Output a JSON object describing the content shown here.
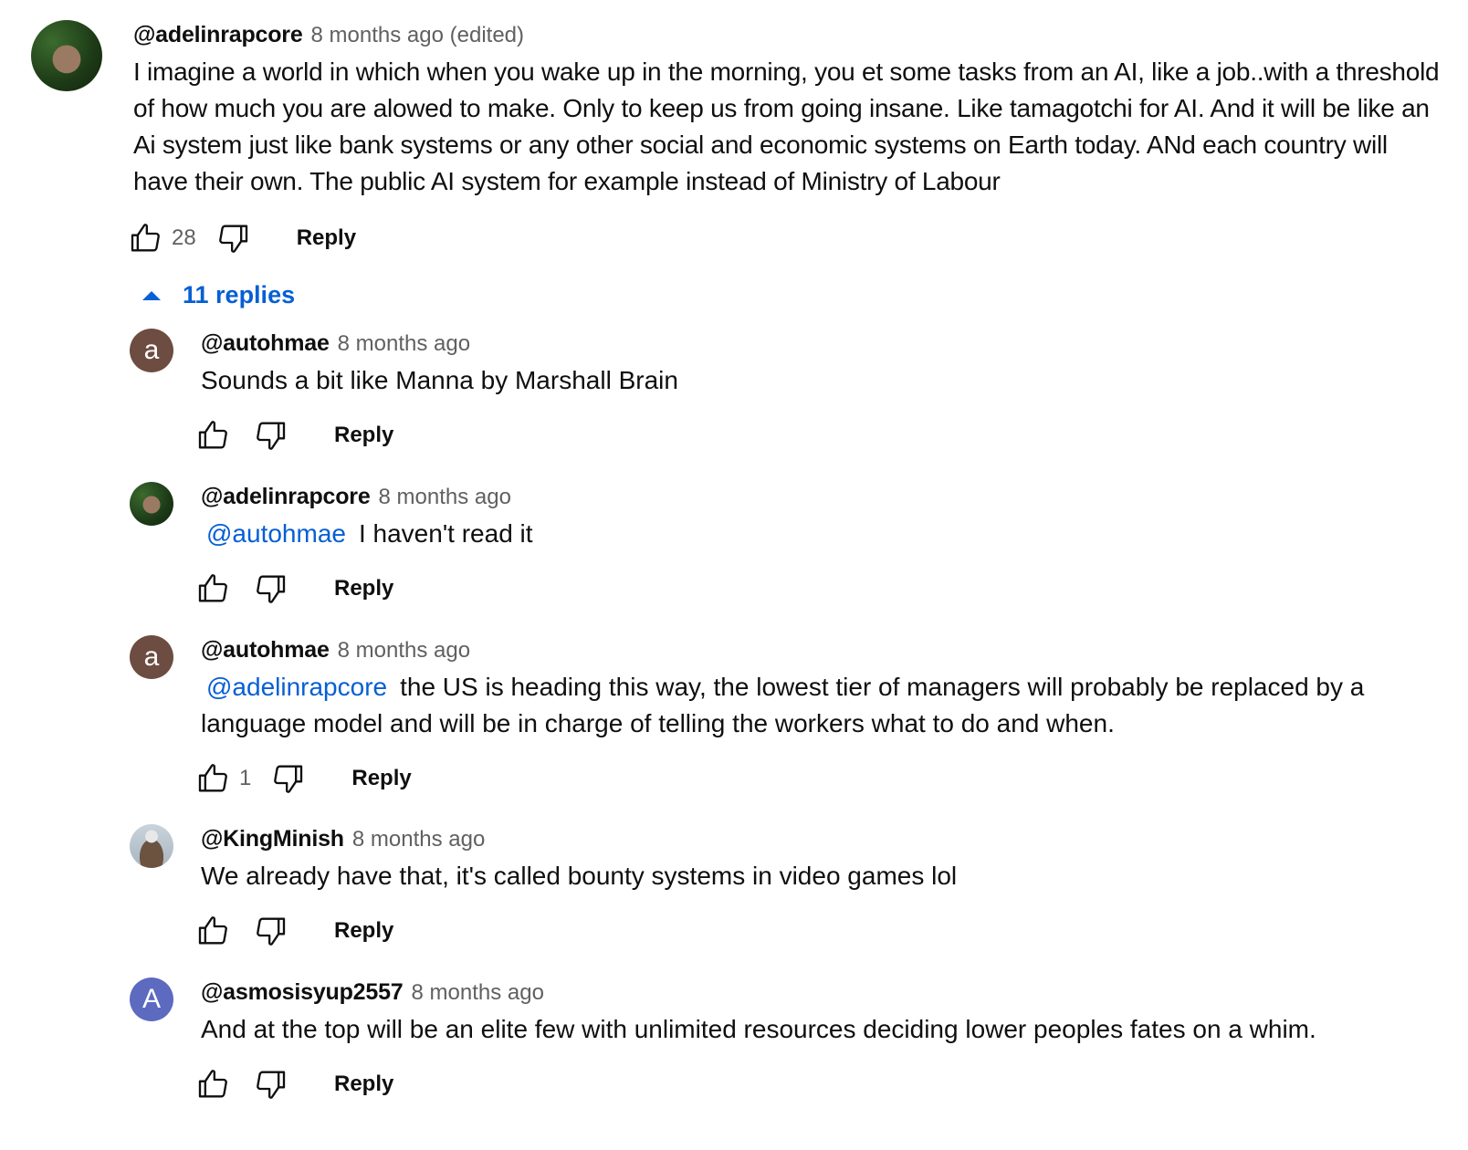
{
  "top_comment": {
    "author": "@adelinrapcore",
    "time": "8 months ago (edited)",
    "text": "I imagine a world in which when you wake up in the morning, you et some tasks from an AI, like a job..with a threshold\nof how much you are alowed to make. Only to keep us from going insane. Like tamagotchi for AI. And it will be like an\nAi system just like bank systems or any other social and economic systems on Earth today. ANd each country will\nhave their own. The public AI system for example instead of Ministry of Labour",
    "likes": "28",
    "reply_label": "Reply",
    "avatar_icon": "profile-photo"
  },
  "replies_toggle": {
    "label": "11 replies",
    "icon": "caret-up-icon"
  },
  "replies": [
    {
      "author": "@autohmae",
      "time": "8 months ago",
      "avatar_letter": "a",
      "avatar_color": "#6d4c41",
      "mention": "",
      "text": "Sounds a bit like Manna by Marshall Brain",
      "likes": "",
      "reply_label": "Reply"
    },
    {
      "author": "@adelinrapcore",
      "time": "8 months ago",
      "avatar_letter": "",
      "mention": "@autohmae",
      "text": "I haven't read it",
      "likes": "",
      "reply_label": "Reply"
    },
    {
      "author": "@autohmae",
      "time": "8 months ago",
      "avatar_letter": "a",
      "avatar_color": "#6d4c41",
      "mention": "@adelinrapcore",
      "text": "the US is heading this way, the lowest tier of managers will probably be replaced by a\nlanguage model and will be in charge of telling the workers what to do and when.",
      "likes": "1",
      "reply_label": "Reply"
    },
    {
      "author": "@KingMinish",
      "time": "8 months ago",
      "avatar_letter": "",
      "mention": "",
      "text": "We already have that, it's called bounty systems in video games lol",
      "likes": "",
      "reply_label": "Reply"
    },
    {
      "author": "@asmosisyup2557",
      "time": "8 months ago",
      "avatar_letter": "A",
      "avatar_color": "#5c6bc0",
      "mention": "",
      "text": "And at the top will be an elite few with unlimited resources deciding lower peoples fates on a whim.",
      "likes": "",
      "reply_label": "Reply"
    }
  ],
  "colors": {
    "link": "#065fd4",
    "meta": "#606060",
    "text": "#0f0f0f"
  }
}
